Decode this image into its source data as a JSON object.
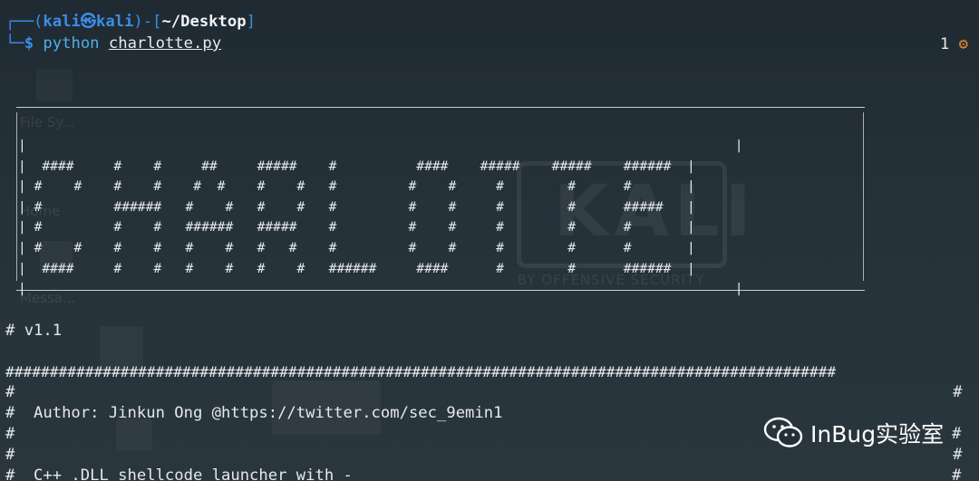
{
  "prompt": {
    "frame_top_left": "┌──(",
    "user": "kali㉿kali",
    "frame_mid": ")-[",
    "dir": "~/Desktop",
    "frame_end": "]",
    "frame_bottom": "└─",
    "dollar": "$",
    "command": "python",
    "argument": "charlotte.py"
  },
  "jobs": {
    "count": "1",
    "icon": "gear-icon"
  },
  "banner": {
    "ascii_art": "|                                                                                         |\n|  ####     #    #     ##     #####    #          ####    #####    #####    ######  |\n| #    #    #    #    #  #    #    #   #         #    #     #        #      #       |\n| #         ######   #    #   #    #   #         #    #     #        #      #####   |\n| #         #    #   ######   #####    #         #    #     #        #      #       |\n| #    #    #    #   #    #   #   #    #         #    #     #        #      #       |\n|  ####     #    #   #    #   #    #   ######     ####      #        #      ######  |\n|                                                                                         |"
  },
  "version": "# v1.1",
  "hash_rule": "##############################################################################################",
  "info_lines": [
    "#                                                                                                    #",
    "#  Author: Jinkun Ong @https://twitter.com/sec_9emin1",
    "#",
    "#                                                                                                    #",
    "#  C++ .DLL shellcode launcher with -"
  ],
  "info_right_marks": [
    "",
    "",
    "#",
    "",
    "#"
  ],
  "watermark": {
    "text": "InBug实验室",
    "icon": "wechat-icon"
  },
  "background": {
    "logo_text": "KALI",
    "logo_sub": "BY OFFENSIVE SECURITY",
    "icon_labels": [
      "File Sy...",
      "Home",
      "Messa..."
    ]
  },
  "colors": {
    "prompt_blue": "#3b8ee8",
    "command_cyan": "#4fb0e8",
    "gear_orange": "#e38b2d",
    "background": "#243038"
  }
}
